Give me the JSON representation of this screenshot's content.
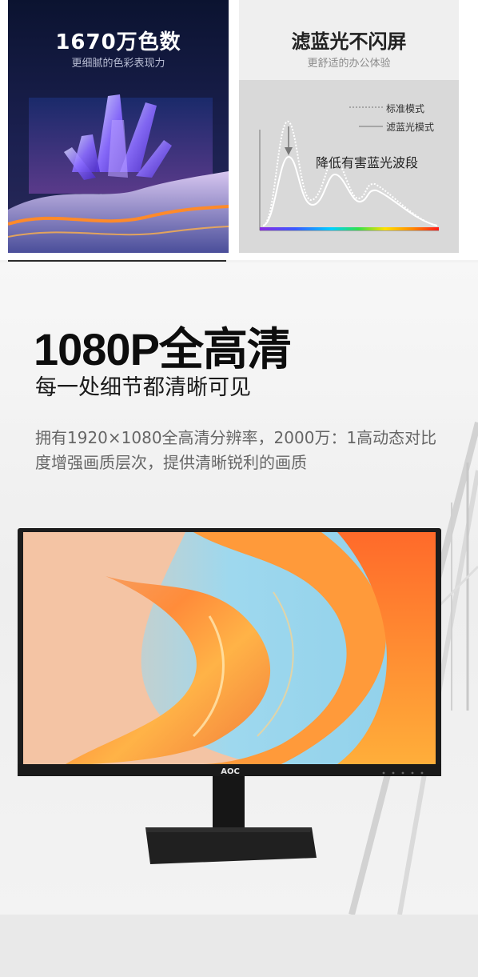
{
  "card_colors": {
    "title": "1670万色数",
    "subtitle": "更细腻的色彩表现力"
  },
  "card_bluelight": {
    "title": "滤蓝光不闪屏",
    "subtitle": "更舒适的办公体验",
    "legend": [
      {
        "label": "标准模式",
        "style": "dotted"
      },
      {
        "label": "滤蓝光模式",
        "style": "solid"
      }
    ],
    "annotation": "降低有害蓝光波段"
  },
  "hero": {
    "headline": "1080P全高清",
    "subheadline": "每一处细节都清晰可见",
    "description": "拥有1920×1080全高清分辨率，2000万：1高动态对比度增强画质层次，提供清晰锐利的画质"
  },
  "monitor": {
    "brand": "AOC"
  },
  "colors": {
    "accent_orange": "#ff7a1a",
    "bezel": "#1a1a1a"
  }
}
